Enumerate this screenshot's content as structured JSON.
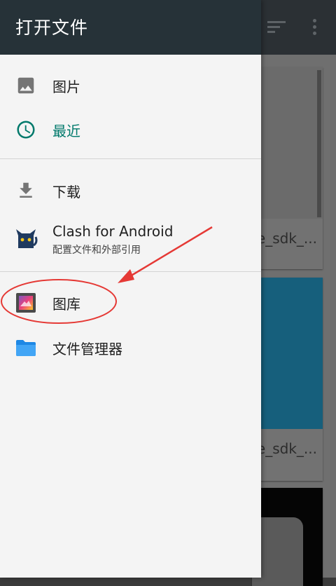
{
  "drawer": {
    "title": "打开文件",
    "items": [
      {
        "label": "图片",
        "icon": "image-icon"
      },
      {
        "label": "最近",
        "icon": "clock-icon",
        "selected": true
      },
      {
        "label": "下载",
        "icon": "download-icon"
      },
      {
        "label": "Clash for Android",
        "sublabel": "配置文件和外部引用",
        "icon": "clash-cat-icon"
      },
      {
        "label": "图库",
        "icon": "gallery-icon"
      },
      {
        "label": "文件管理器",
        "icon": "folder-icon"
      }
    ]
  },
  "background": {
    "cards": [
      {
        "caption": "e_sdk_..."
      },
      {
        "caption": "e_sdk_..."
      }
    ]
  },
  "colors": {
    "header": "#263238",
    "accent": "#00796b",
    "annotation": "#e53935",
    "folder": "#2196f3"
  }
}
